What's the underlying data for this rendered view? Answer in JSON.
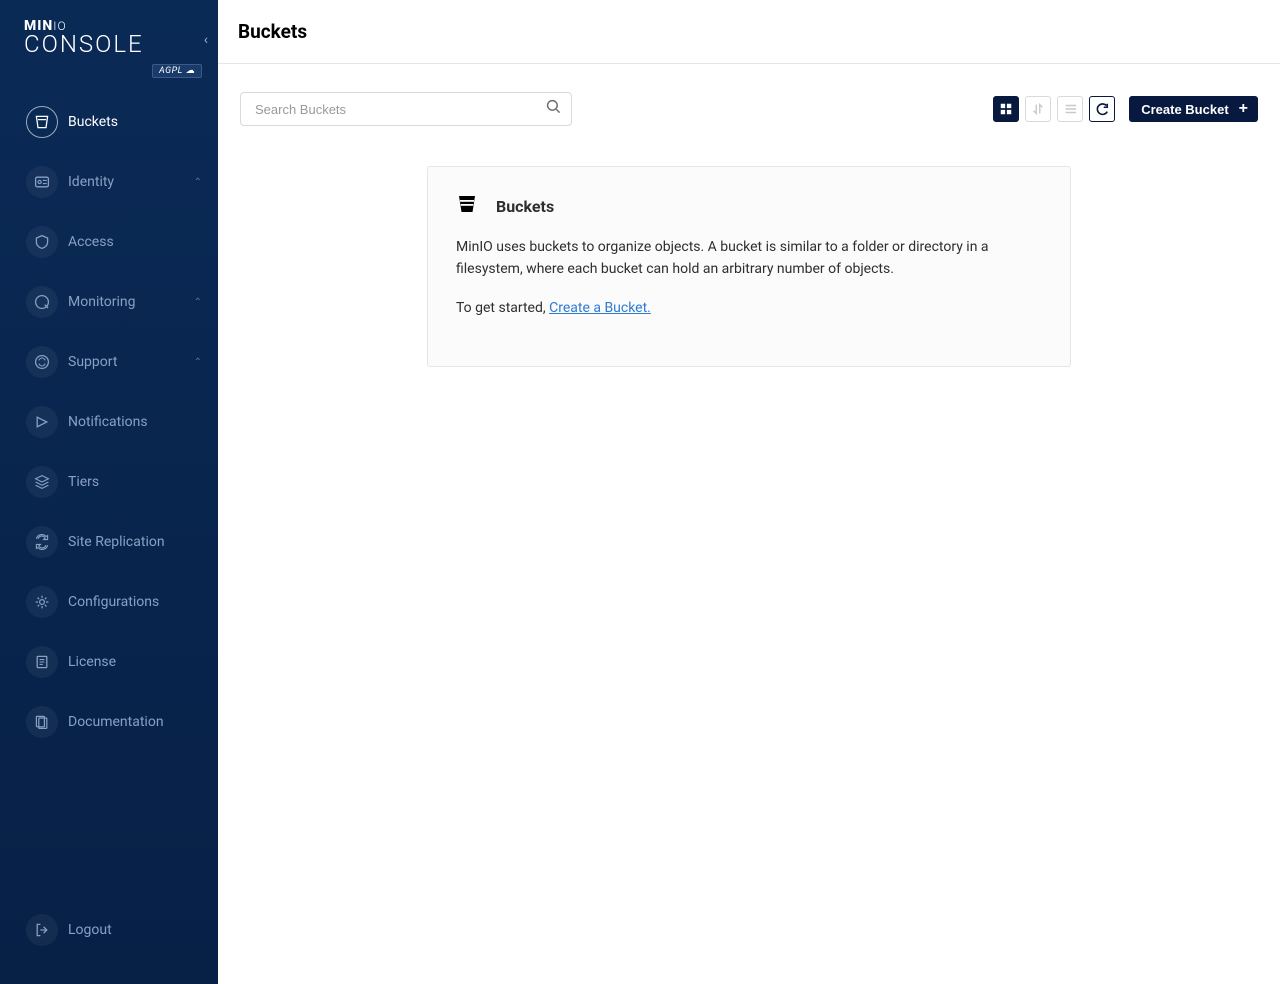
{
  "brand": {
    "name_prefix": "MIN",
    "name_suffix": "IO",
    "product": "CONSOLE",
    "license_badge": "AGPL ☁"
  },
  "sidebar": {
    "items": [
      {
        "label": "Buckets",
        "icon": "bucket-icon",
        "active": true,
        "expandable": false
      },
      {
        "label": "Identity",
        "icon": "identity-icon",
        "active": false,
        "expandable": true
      },
      {
        "label": "Access",
        "icon": "access-icon",
        "active": false,
        "expandable": false
      },
      {
        "label": "Monitoring",
        "icon": "monitoring-icon",
        "active": false,
        "expandable": true
      },
      {
        "label": "Support",
        "icon": "support-icon",
        "active": false,
        "expandable": true
      },
      {
        "label": "Notifications",
        "icon": "notifications-icon",
        "active": false,
        "expandable": false
      },
      {
        "label": "Tiers",
        "icon": "tiers-icon",
        "active": false,
        "expandable": false
      },
      {
        "label": "Site Replication",
        "icon": "replication-icon",
        "active": false,
        "expandable": false
      },
      {
        "label": "Configurations",
        "icon": "configurations-icon",
        "active": false,
        "expandable": false
      },
      {
        "label": "License",
        "icon": "license-icon",
        "active": false,
        "expandable": false
      },
      {
        "label": "Documentation",
        "icon": "documentation-icon",
        "active": false,
        "expandable": false
      }
    ],
    "footer": {
      "label": "Logout",
      "icon": "logout-icon"
    }
  },
  "page": {
    "title": "Buckets",
    "search_placeholder": "Search Buckets",
    "create_button": "Create Bucket",
    "info_card": {
      "title": "Buckets",
      "description": "MinIO uses buckets to organize objects. A bucket is similar to a folder or directory in a filesystem, where each bucket can hold an arbitrary number of objects.",
      "cta_prefix": "To get started, ",
      "cta_link": "Create a Bucket."
    }
  }
}
